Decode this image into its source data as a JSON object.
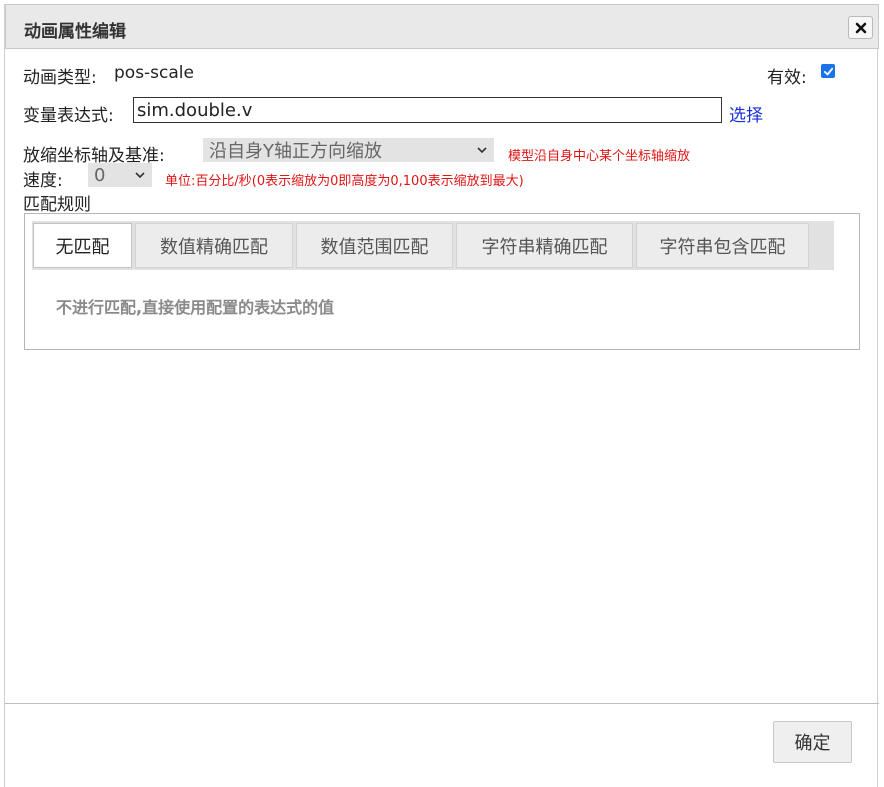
{
  "dialog": {
    "title": "动画属性编辑",
    "close_icon": "close-icon"
  },
  "anim_type": {
    "label": "动画类型:",
    "value": "pos-scale"
  },
  "enabled": {
    "label": "有效:",
    "checked": true
  },
  "expression": {
    "label": "变量表达式:",
    "value": "sim.double.v",
    "select_link": "选择"
  },
  "scale_axis": {
    "label": "放缩坐标轴及基准:",
    "selected": "沿自身Y轴正方向缩放",
    "hint": "模型沿自身中心某个坐标轴缩放"
  },
  "speed": {
    "label": "速度:",
    "selected": "0",
    "hint": "单位:百分比/秒(0表示缩放为0即高度为0,100表示缩放到最大)"
  },
  "match_rules": {
    "label": "匹配规则",
    "tabs": [
      {
        "label": "无匹配",
        "active": true
      },
      {
        "label": "数值精确匹配",
        "active": false
      },
      {
        "label": "数值范围匹配",
        "active": false
      },
      {
        "label": "字符串精确匹配",
        "active": false
      },
      {
        "label": "字符串包含匹配",
        "active": false
      }
    ],
    "description": "不进行匹配,直接使用配置的表达式的值"
  },
  "footer": {
    "ok_label": "确定"
  },
  "colors": {
    "accent": "#1a73e8",
    "hint_red": "#e01515",
    "link_blue": "#1a2fd6"
  }
}
